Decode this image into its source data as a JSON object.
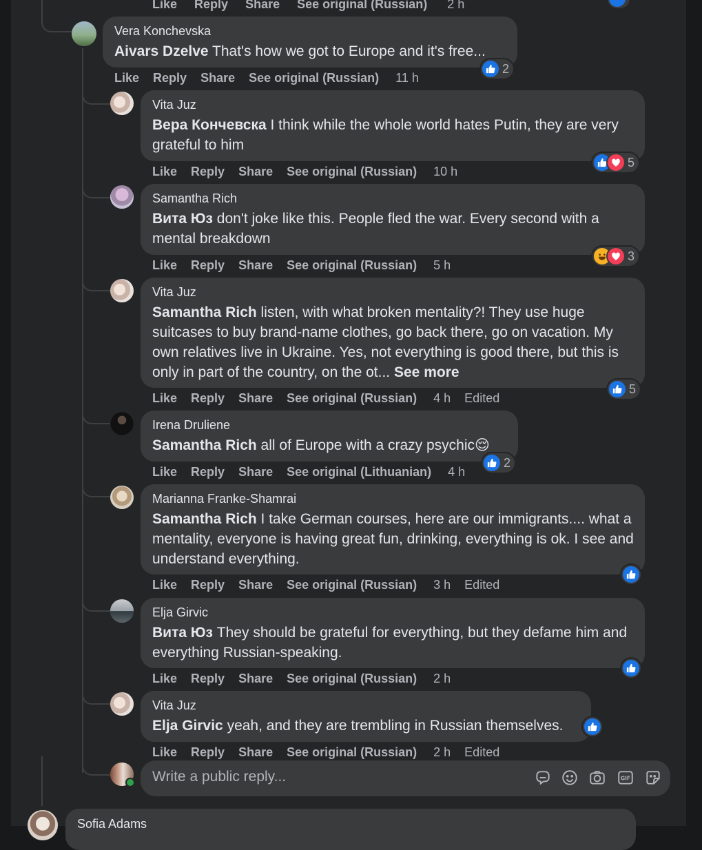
{
  "top_partial": {
    "actions": [
      "Like",
      "Reply",
      "Share",
      "See original (Russian)"
    ],
    "time": "2 h"
  },
  "comments": [
    {
      "author": "Vera Konchevska",
      "mention": "Aivars Dzelve",
      "text": " That's how we got to Europe and it's free...",
      "actions": [
        "Like",
        "Reply",
        "Share",
        "See original (Russian)"
      ],
      "time": "11 h",
      "reactions": {
        "icons": [
          "like"
        ],
        "count": "2"
      }
    },
    {
      "author": "Vita Juz",
      "mention": "Вера Кончевска",
      "text": " I think while the whole world hates Putin, they are very grateful to him",
      "actions": [
        "Like",
        "Reply",
        "Share",
        "See original (Russian)"
      ],
      "time": "10 h",
      "reactions": {
        "icons": [
          "like",
          "love"
        ],
        "count": "5"
      }
    },
    {
      "author": "Samantha Rich",
      "mention": "Вита Юз",
      "text": " don't joke like this. People fled the war. Every second with a mental breakdown",
      "actions": [
        "Like",
        "Reply",
        "Share",
        "See original (Russian)"
      ],
      "time": "5 h",
      "reactions": {
        "icons": [
          "haha",
          "love"
        ],
        "count": "3"
      }
    },
    {
      "author": "Vita Juz",
      "mention": "Samantha Rich",
      "text": " listen, with what broken mentality?! They use huge suitcases to buy brand-name clothes, go back there, go on vacation. My own relatives live in Ukraine. Yes, not everything is good there, but this is only in part of the country, on the ot...",
      "see_more": "See more",
      "actions": [
        "Like",
        "Reply",
        "Share",
        "See original (Russian)"
      ],
      "time": "4 h",
      "edited": "Edited",
      "reactions": {
        "icons": [
          "like"
        ],
        "count": "5"
      }
    },
    {
      "author": "Irena Druliene",
      "mention": "Samantha Rich",
      "text": " all of Europe with a crazy psychic😌",
      "actions": [
        "Like",
        "Reply",
        "Share",
        "See original (Lithuanian)"
      ],
      "time": "4 h",
      "reactions": {
        "icons": [
          "like"
        ],
        "count": "2"
      }
    },
    {
      "author": "Marianna Franke-Shamrai",
      "mention": "Samantha Rich",
      "text": " I take German courses, here are our immigrants.... what a mentality, everyone is having great fun, drinking, everything is ok. I see and understand everything.",
      "actions": [
        "Like",
        "Reply",
        "Share",
        "See original (Russian)"
      ],
      "time": "3 h",
      "edited": "Edited",
      "reactions": {
        "icons": [
          "like"
        ],
        "count": ""
      }
    },
    {
      "author": "Elja Girvic",
      "mention": "Вита Юз",
      "text": " They should be grateful for everything, but they defame him and everything Russian-speaking.",
      "actions": [
        "Like",
        "Reply",
        "Share",
        "See original (Russian)"
      ],
      "time": "2 h",
      "reactions": {
        "icons": [
          "like"
        ],
        "count": ""
      }
    },
    {
      "author": "Vita Juz",
      "mention": "Elja Girvic",
      "text": " yeah, and they are trembling in Russian themselves.",
      "actions": [
        "Like",
        "Reply",
        "Share",
        "See original (Russian)"
      ],
      "time": "2 h",
      "edited": "Edited",
      "reactions": {
        "icons": [
          "like"
        ],
        "count": ""
      }
    }
  ],
  "reply_box": {
    "placeholder": "Write a public reply...",
    "tools": [
      "sticker-icon",
      "emoji-icon",
      "camera-icon",
      "gif-icon",
      "avatar-sticker-icon"
    ]
  },
  "next_comment": {
    "author": "Sofia Adams"
  },
  "colors": {
    "like": "#1b74e4",
    "love": "#f33e58",
    "haha": "#f7b125",
    "background": "#242526",
    "bubble": "#3a3b3c"
  }
}
